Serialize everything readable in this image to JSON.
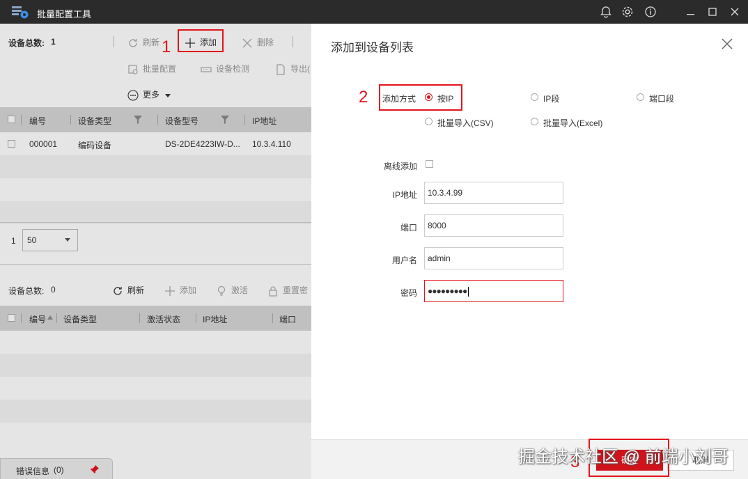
{
  "app": {
    "title": "批量配置工具"
  },
  "top_panel": {
    "total_label": "设备总数:",
    "total_count": "1",
    "refresh": "刷新",
    "add": "添加",
    "delete": "删除",
    "batch_config": "批量配置",
    "device_check": "设备检测",
    "export": "导出(",
    "more": "更多",
    "columns": [
      "编号",
      "设备类型",
      "设备型号",
      "IP地址"
    ],
    "rows": [
      {
        "id": "000001",
        "type": "编码设备",
        "model": "DS-2DE4223IW-D...",
        "ip": "10.3.4.110"
      }
    ],
    "page": "1",
    "page_size": "50"
  },
  "bottom_panel": {
    "total_label": "设备总数:",
    "total_count": "0",
    "refresh": "刷新",
    "add": "添加",
    "activate": "激活",
    "reset": "重置密",
    "columns": [
      "编号",
      "设备类型",
      "激活状态",
      "IP地址",
      "端口"
    ]
  },
  "status_bar": {
    "errors_label": "错误信息",
    "errors_count": "(0)"
  },
  "dialog": {
    "title": "添加到设备列表",
    "mode_label": "添加方式",
    "modes": [
      "按IP",
      "IP段",
      "端口段",
      "批量导入(CSV)",
      "批量导入(Excel)"
    ],
    "offline_label": "离线添加",
    "ip_label": "IP地址",
    "ip_value": "10.3.4.99",
    "port_label": "端口",
    "port_value": "8000",
    "user_label": "用户名",
    "user_value": "admin",
    "password_label": "密码",
    "password_value": "●●●●●●●●●",
    "ok": "确定",
    "cancel": "取消"
  },
  "annotations": {
    "step1": "1",
    "step2": "2",
    "step3": "3"
  },
  "watermark": "掘金技术社区 @ 前端小刘哥",
  "colors": {
    "accent": "#d0121b",
    "annotation": "#e3141b",
    "titlebar": "#2b2b2b"
  }
}
